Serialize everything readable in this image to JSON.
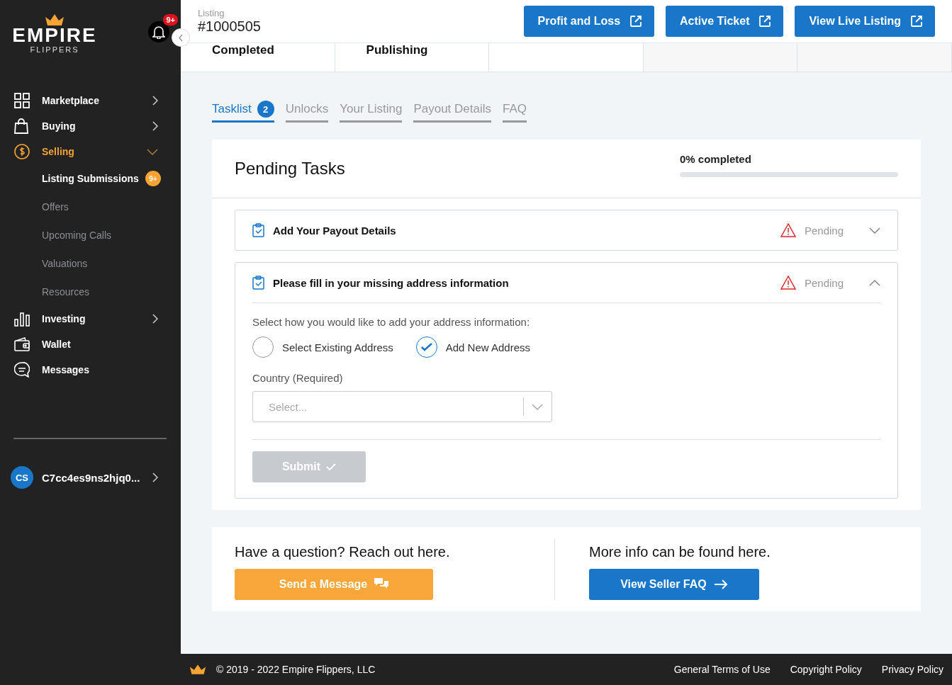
{
  "sidebar": {
    "logo": {
      "wordmark": "EMPIRE",
      "tagline": "FLIPPERS"
    },
    "notifications": {
      "count": "9+"
    },
    "items": [
      {
        "label": "Marketplace",
        "selected": false,
        "expanded": false
      },
      {
        "label": "Buying",
        "selected": false,
        "expanded": false
      },
      {
        "label": "Selling",
        "selected": true,
        "expanded": true,
        "children": [
          {
            "label": "Listing Submissions",
            "selected": true,
            "badge": "9+"
          },
          {
            "label": "Offers",
            "selected": false
          },
          {
            "label": "Upcoming Calls",
            "selected": false
          },
          {
            "label": "Valuations",
            "selected": false
          },
          {
            "label": "Resources",
            "selected": false
          }
        ]
      },
      {
        "label": "Investing",
        "selected": false,
        "expanded": false
      },
      {
        "label": "Wallet",
        "selected": false
      },
      {
        "label": "Messages",
        "selected": false
      }
    ],
    "user": {
      "initials": "CS",
      "name": "C7cc4es9ns2hjq0..."
    }
  },
  "header": {
    "caption": "Listing",
    "listing_id": "#1000505",
    "buttons": [
      "Profit and Loss",
      "Active Ticket",
      "View Live Listing"
    ]
  },
  "steps": [
    {
      "label": "Completed"
    },
    {
      "label": "Publishing"
    }
  ],
  "tabs": [
    {
      "label": "Tasklist",
      "selected": true,
      "badge": "2"
    },
    {
      "label": "Unlocks",
      "selected": false
    },
    {
      "label": "Your Listing",
      "selected": false
    },
    {
      "label": "Payout Details",
      "selected": false
    },
    {
      "label": "FAQ",
      "selected": false
    }
  ],
  "tasks_card": {
    "title": "Pending Tasks",
    "progress_label": "0% completed",
    "level": 0,
    "tasks": [
      {
        "title": "Add Your Payout Details",
        "status": "Pending",
        "expanded": false
      },
      {
        "title": "Please fill in your missing address information",
        "status": "Pending",
        "expanded": true,
        "form": {
          "prompt": "Select how you would like to add your address information:",
          "options": [
            {
              "label": "Select Existing Address",
              "selected": false
            },
            {
              "label": "Add New Address",
              "selected": true
            }
          ],
          "country_label": "Country (Required)",
          "country_placeholder": "Select...",
          "submit": {
            "label": "Submit",
            "disabled": true
          }
        }
      }
    ]
  },
  "help": {
    "question_title": "Have a question? Reach out here.",
    "message_button": "Send a Message",
    "faq_title": "More info can be found here.",
    "faq_button": "View Seller FAQ"
  },
  "footer": {
    "copyright": "© 2019 - 2022 Empire Flippers, LLC",
    "links": [
      "General Terms of Use",
      "Copyright Policy",
      "Privacy Policy"
    ]
  }
}
